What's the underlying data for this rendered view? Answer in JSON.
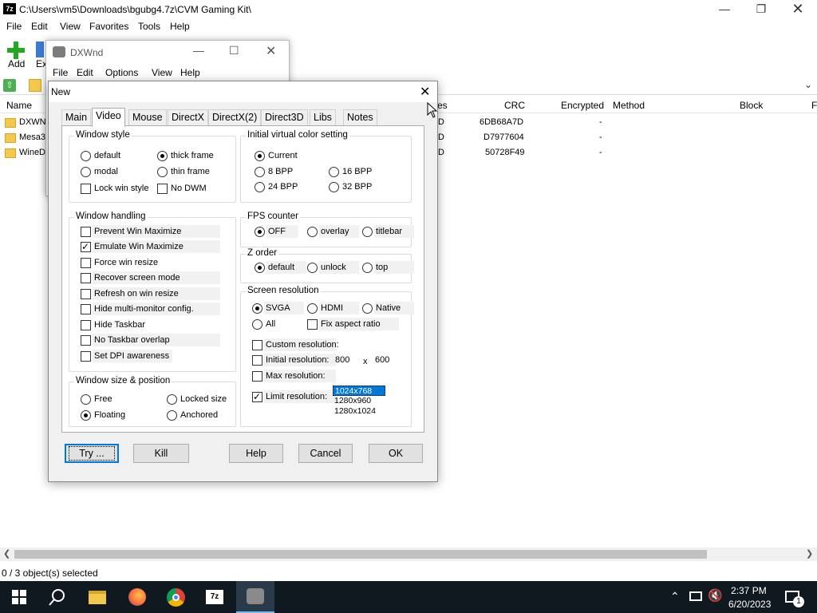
{
  "app": {
    "title": "C:\\Users\\vm5\\Downloads\\bgubg4.7z\\CVM Gaming Kit\\",
    "icon": "7z",
    "menu": [
      "File",
      "Edit",
      "View",
      "Favorites",
      "Tools",
      "Help"
    ],
    "toolbar": {
      "add_label": "Add",
      "ex_label": "Ex"
    },
    "columns": {
      "name": "Name",
      "es": "es",
      "crc": "CRC",
      "encrypted": "Encrypted",
      "method": "Method",
      "block": "Block",
      "f": "F"
    },
    "rows": [
      {
        "name": "DXWN",
        "d": "D",
        "crc": "6DB68A7D",
        "encrypted": "-"
      },
      {
        "name": "Mesa3",
        "d": "D",
        "crc": "D7977604",
        "encrypted": "-"
      },
      {
        "name": "WineD",
        "d": "D",
        "crc": "50728F49",
        "encrypted": "-"
      }
    ],
    "status": "0 / 3 object(s) selected"
  },
  "dxwnd": {
    "title": "DXWnd",
    "menu": [
      "File",
      "Edit",
      "Options",
      "View",
      "Help"
    ]
  },
  "dialog": {
    "title": "New",
    "tabs": [
      "Main",
      "Video",
      "Mouse",
      "DirectX",
      "DirectX(2)",
      "Direct3D",
      "Libs",
      "Notes"
    ],
    "active_tab": "Video",
    "window_style": {
      "legend": "Window style",
      "default": "default",
      "thick_frame": "thick frame",
      "modal": "modal",
      "thin_frame": "thin frame",
      "lock_win_style": "Lock win style",
      "no_dwm": "No DWM"
    },
    "color_setting": {
      "legend": "Initial virtual color setting",
      "current": "Current",
      "bpp8": "8 BPP",
      "bpp16": "16 BPP",
      "bpp24": "24 BPP",
      "bpp32": "32 BPP"
    },
    "window_handling": {
      "legend": "Window handling",
      "items": [
        {
          "label": "Prevent Win Maximize",
          "checked": false
        },
        {
          "label": "Emulate Win Maximize",
          "checked": true
        },
        {
          "label": "Force win resize",
          "checked": false
        },
        {
          "label": "Recover screen mode",
          "checked": false
        },
        {
          "label": "Refresh on win resize",
          "checked": false
        },
        {
          "label": "Hide multi-monitor config.",
          "checked": false
        },
        {
          "label": "Hide Taskbar",
          "checked": false
        },
        {
          "label": "No Taskbar overlap",
          "checked": false
        },
        {
          "label": "Set DPI awareness",
          "checked": false
        }
      ]
    },
    "fps_counter": {
      "legend": "FPS counter",
      "off": "OFF",
      "overlay": "overlay",
      "titlebar": "titlebar"
    },
    "z_order": {
      "legend": "Z order",
      "default": "default",
      "unlock": "unlock",
      "top": "top"
    },
    "screen_resolution": {
      "legend": "Screen resolution",
      "svga": "SVGA",
      "hdmi": "HDMI",
      "native": "Native",
      "all": "All",
      "fix_aspect": "Fix aspect ratio",
      "custom": "Custom resolution:",
      "initial": "Initial resolution:",
      "init_w": "800",
      "x": "x",
      "init_h": "600",
      "max": "Max resolution:",
      "limit": "Limit  resolution:",
      "limit_options": [
        "1024x768",
        "1280x960",
        "1280x1024"
      ]
    },
    "size_position": {
      "legend": "Window size & position",
      "free": "Free",
      "locked": "Locked size",
      "floating": "Floating",
      "anchored": "Anchored"
    },
    "buttons": {
      "try": "Try ...",
      "kill": "Kill",
      "help": "Help",
      "cancel": "Cancel",
      "ok": "OK"
    }
  },
  "taskbar": {
    "time": "2:37 PM",
    "date": "6/20/2023",
    "notifications": "1"
  },
  "colors": {
    "accent": "#0078d7",
    "taskbar": "#101820",
    "highlight": "#0078d7"
  }
}
